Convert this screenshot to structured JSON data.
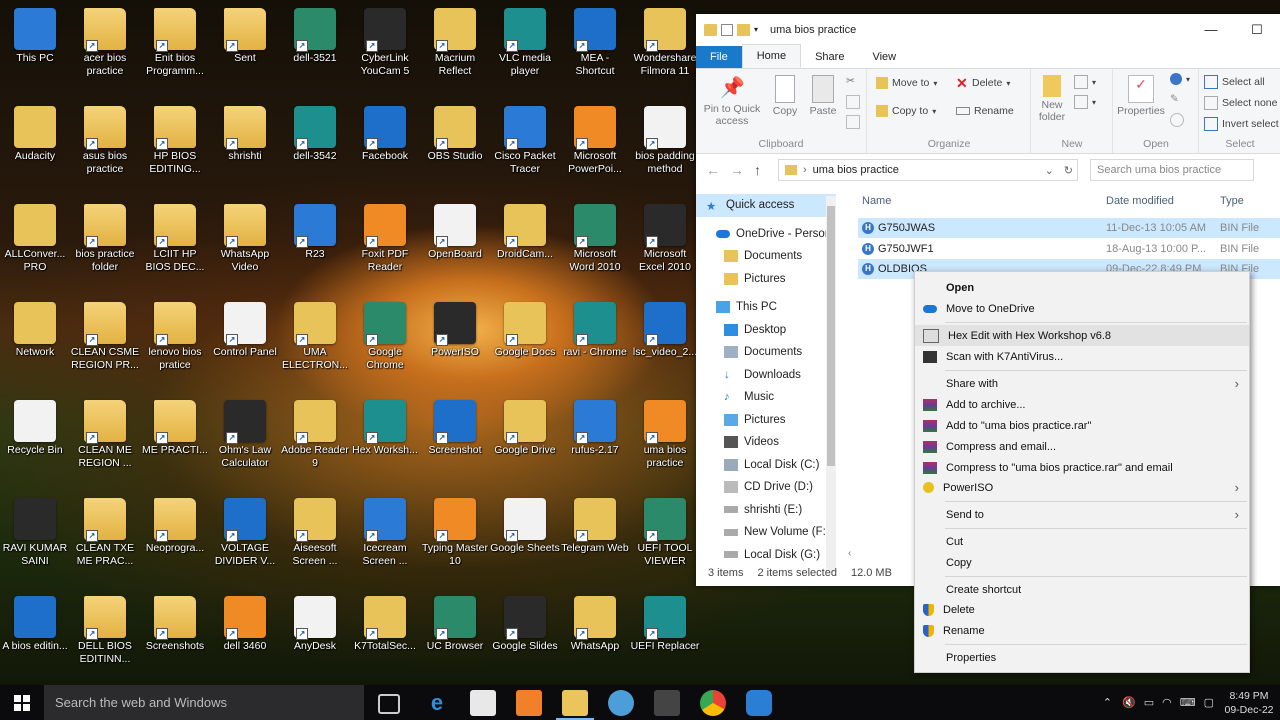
{
  "desktop_icons": [
    {
      "label": "This PC"
    },
    {
      "label": "acer bios practice"
    },
    {
      "label": "Enit bios Programm..."
    },
    {
      "label": "Sent"
    },
    {
      "label": "dell-3521"
    },
    {
      "label": "CyberLink YouCam 5"
    },
    {
      "label": "Macrium Reflect"
    },
    {
      "label": "VLC media player"
    },
    {
      "label": "MEA - Shortcut"
    },
    {
      "label": "Wondershare Filmora 11"
    },
    {
      "label": "Audacity"
    },
    {
      "label": "asus bios practice"
    },
    {
      "label": "HP BIOS EDITING..."
    },
    {
      "label": "shrishti"
    },
    {
      "label": "dell-3542"
    },
    {
      "label": "Facebook"
    },
    {
      "label": "OBS Studio"
    },
    {
      "label": "Cisco Packet Tracer"
    },
    {
      "label": "Microsoft PowerPoi..."
    },
    {
      "label": "bios padding method"
    },
    {
      "label": "ALLConver... PRO"
    },
    {
      "label": "bios practice folder"
    },
    {
      "label": "LCIIT HP BIOS DEC..."
    },
    {
      "label": "WhatsApp Video"
    },
    {
      "label": "R23"
    },
    {
      "label": "Foxit PDF Reader"
    },
    {
      "label": "OpenBoard"
    },
    {
      "label": "DroidCam..."
    },
    {
      "label": "Microsoft Word 2010"
    },
    {
      "label": "Microsoft Excel 2010"
    },
    {
      "label": "Network"
    },
    {
      "label": "CLEAN CSME REGION PR..."
    },
    {
      "label": "lenovo bios pratice"
    },
    {
      "label": "Control Panel"
    },
    {
      "label": "UMA ELECTRON..."
    },
    {
      "label": "Google Chrome"
    },
    {
      "label": "PowerISO"
    },
    {
      "label": "Google Docs"
    },
    {
      "label": "ravi - Chrome"
    },
    {
      "label": "lsc_video_2..."
    },
    {
      "label": "Recycle Bin"
    },
    {
      "label": "CLEAN ME REGION ..."
    },
    {
      "label": "ME PRACTI..."
    },
    {
      "label": "Ohm's Law Calculator"
    },
    {
      "label": "Adobe Reader 9"
    },
    {
      "label": "Hex Worksh..."
    },
    {
      "label": "Screenshot"
    },
    {
      "label": "Google Drive"
    },
    {
      "label": "rufus-2.17"
    },
    {
      "label": "uma bios practice"
    },
    {
      "label": "RAVI KUMAR SAINI"
    },
    {
      "label": "CLEAN TXE ME PRAC..."
    },
    {
      "label": "Neoprogra..."
    },
    {
      "label": "VOLTAGE DIVIDER V..."
    },
    {
      "label": "Aiseesoft Screen ..."
    },
    {
      "label": "Icecream Screen ..."
    },
    {
      "label": "Typing Master 10"
    },
    {
      "label": "Google Sheets"
    },
    {
      "label": "Telegram Web"
    },
    {
      "label": "UEFI TOOL VIEWER"
    },
    {
      "label": "A bios editin..."
    },
    {
      "label": "DELL BIOS EDITINN..."
    },
    {
      "label": "Screenshots"
    },
    {
      "label": "dell 3460"
    },
    {
      "label": "AnyDesk"
    },
    {
      "label": "K7TotalSec..."
    },
    {
      "label": "UC Browser"
    },
    {
      "label": "Google Slides"
    },
    {
      "label": "WhatsApp"
    },
    {
      "label": "UEFI Replacer"
    }
  ],
  "explorer": {
    "title": "uma bios practice",
    "tabs": [
      "File",
      "Home",
      "Share",
      "View"
    ],
    "ribbon": {
      "pin": "Pin to Quick access",
      "copy": "Copy",
      "paste": "Paste",
      "clipboard": "Clipboard",
      "move_to": "Move to",
      "copy_to": "Copy to",
      "delete": "Delete",
      "rename": "Rename",
      "organize": "Organize",
      "new_folder": "New folder",
      "new": "New",
      "properties": "Properties",
      "open": "Open",
      "select_all": "Select all",
      "select_none": "Select none",
      "invert_selection": "Invert select",
      "select": "Select"
    },
    "address": "uma bios practice",
    "search_placeholder": "Search uma bios practice",
    "nav": [
      "Quick access",
      "OneDrive - Persor",
      "Documents",
      "Pictures",
      "This PC",
      "Desktop",
      "Documents",
      "Downloads",
      "Music",
      "Pictures",
      "Videos",
      "Local Disk (C:)",
      "CD Drive (D:)",
      "shrishti (E:)",
      "New Volume (F:)",
      "Local Disk (G:)"
    ],
    "columns": {
      "name": "Name",
      "date": "Date modified",
      "type": "Type"
    },
    "files": [
      {
        "name": "G750JWAS",
        "date": "11-Dec-13 10:05 AM",
        "type": "BIN File"
      },
      {
        "name": "G750JWF1",
        "date": "18-Aug-13 10:00 P...",
        "type": "BIN File"
      },
      {
        "name": "OLDBIOS",
        "date": "09-Dec-22 8:49 PM",
        "type": "BIN File"
      }
    ],
    "status": {
      "items": "3 items",
      "selected": "2 items selected",
      "size": "12.0 MB"
    }
  },
  "context_menu": {
    "open": "Open",
    "move_onedrive": "Move to OneDrive",
    "hex_edit": "Hex Edit with Hex Workshop v6.8",
    "scan": "Scan with K7AntiVirus...",
    "share_with": "Share with",
    "add_archive": "Add to archive...",
    "add_rar": "Add to \"uma bios practice.rar\"",
    "compress_email": "Compress and email...",
    "compress_rar_email": "Compress to \"uma bios practice.rar\" and email",
    "poweriso": "PowerISO",
    "send_to": "Send to",
    "cut": "Cut",
    "copy": "Copy",
    "create_shortcut": "Create shortcut",
    "delete": "Delete",
    "rename": "Rename",
    "properties": "Properties"
  },
  "taskbar": {
    "search_placeholder": "Search the web and Windows",
    "time": "8:49 PM",
    "date": "09-Dec-22"
  }
}
